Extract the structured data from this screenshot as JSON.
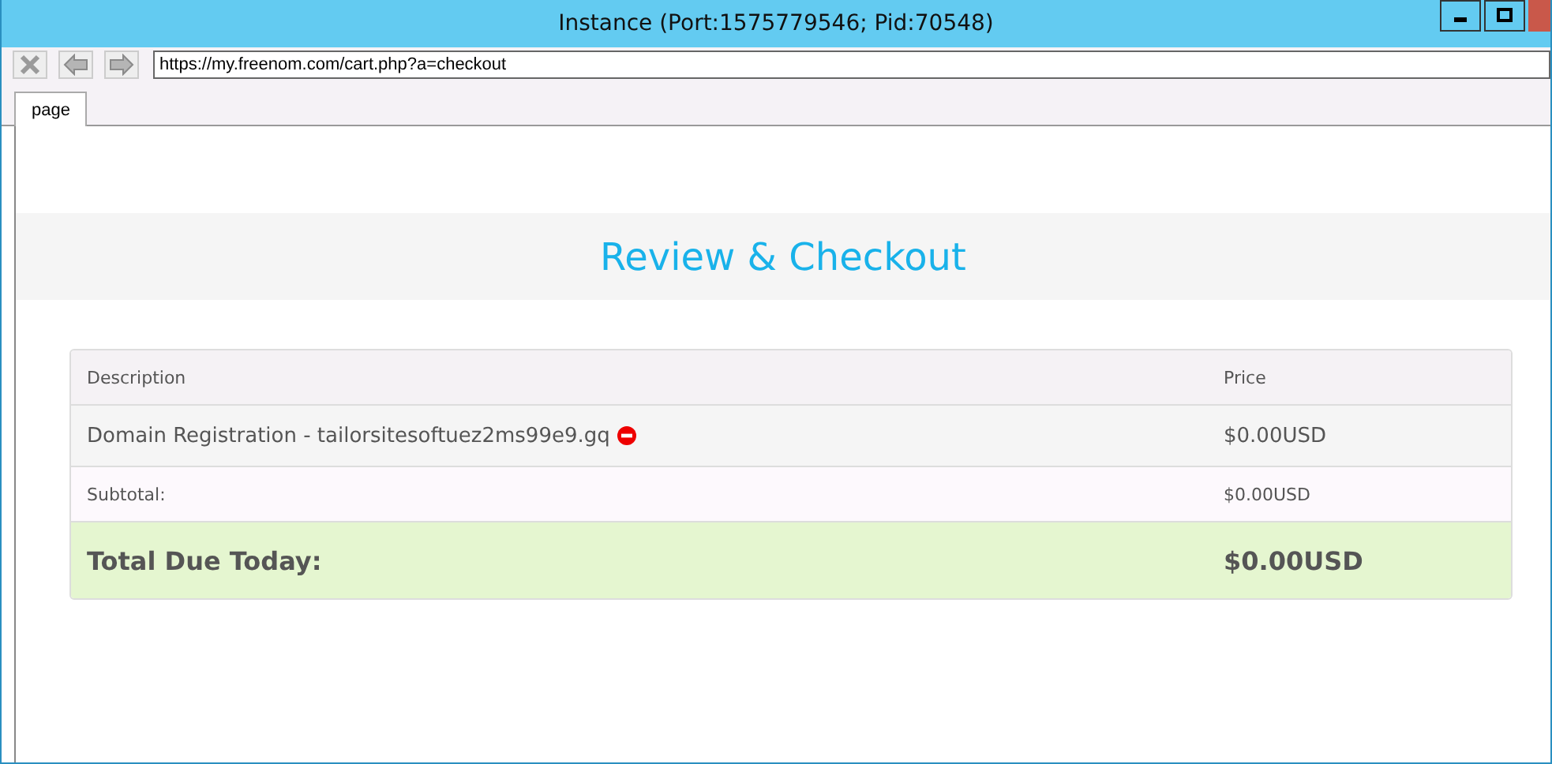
{
  "window": {
    "title": "Instance (Port:1575779546; Pid:70548)"
  },
  "address_bar": {
    "value": "https://my.freenom.com/cart.php?a=checkout"
  },
  "tabs": [
    {
      "label": "page",
      "selected": true
    }
  ],
  "page": {
    "heading": "Review & Checkout",
    "table": {
      "columns": [
        "Description",
        "Price"
      ],
      "rows": [
        {
          "kind": "item",
          "description": "Domain Registration - tailorsitesoftuez2ms99e9.gq",
          "price": "$0.00USD"
        },
        {
          "kind": "subtotal",
          "description": "Subtotal:",
          "price": "$0.00USD"
        },
        {
          "kind": "total",
          "description": "Total Due Today:",
          "price": "$0.00USD"
        }
      ]
    }
  }
}
